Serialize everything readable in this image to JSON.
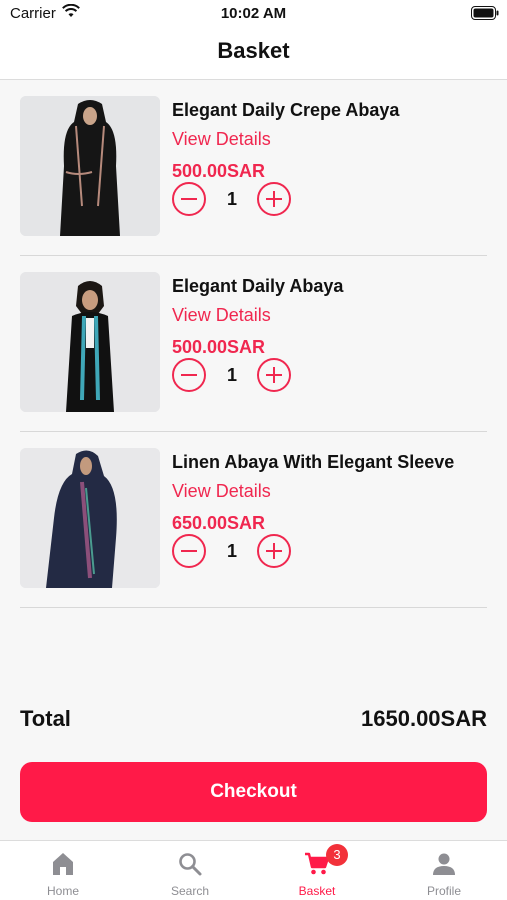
{
  "status_bar": {
    "carrier": "Carrier",
    "time": "10:02 AM"
  },
  "header": {
    "title": "Basket"
  },
  "items": [
    {
      "name": "Elegant Daily Crepe Abaya",
      "view_details": "View Details",
      "price": "500.00SAR",
      "quantity": "1"
    },
    {
      "name": "Elegant Daily Abaya",
      "view_details": "View Details",
      "price": "500.00SAR",
      "quantity": "1"
    },
    {
      "name": "Linen Abaya With Elegant Sleeve",
      "view_details": "View Details",
      "price": "650.00SAR",
      "quantity": "1"
    }
  ],
  "summary": {
    "total_label": "Total",
    "total_value": "1650.00SAR"
  },
  "checkout": {
    "label": "Checkout"
  },
  "tab_bar": {
    "tabs": [
      {
        "label": "Home",
        "icon": "home-icon"
      },
      {
        "label": "Search",
        "icon": "search-icon"
      },
      {
        "label": "Basket",
        "icon": "cart-icon",
        "badge": "3"
      },
      {
        "label": "Profile",
        "icon": "person-icon"
      }
    ],
    "active_color": "#ff1a48",
    "inactive_color": "#8e8e93"
  },
  "colors": {
    "accent": "#f0274f",
    "checkout": "#ff1a48"
  }
}
